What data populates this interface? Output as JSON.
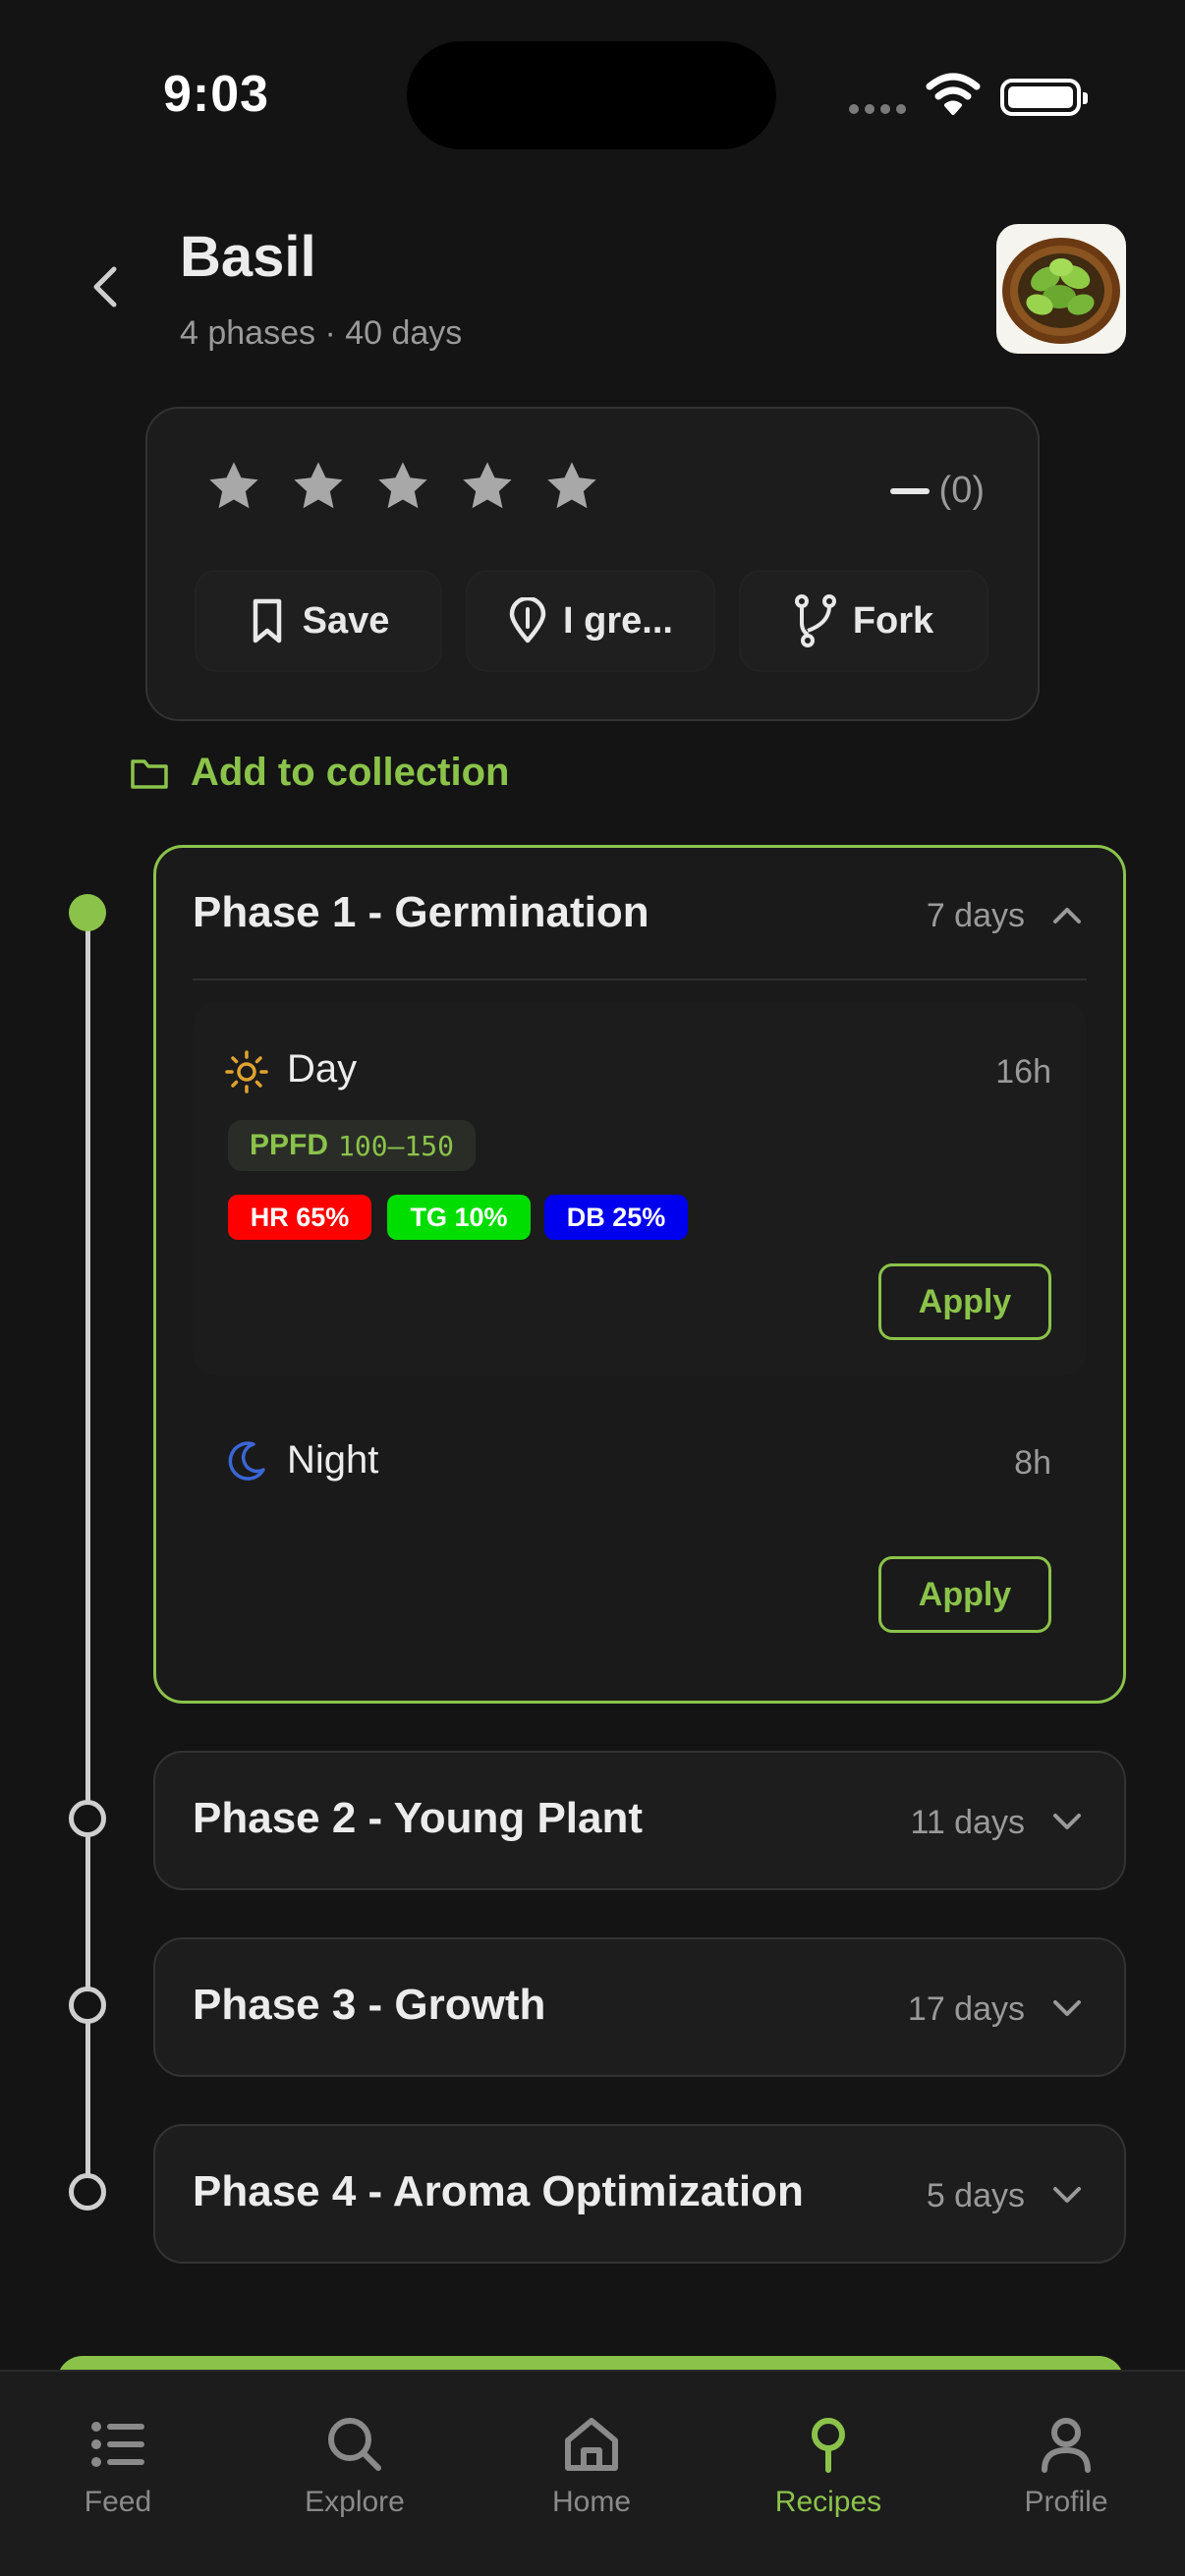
{
  "status": {
    "time": "9:03"
  },
  "header": {
    "title": "Basil",
    "subtitle": "4 phases · 40 days",
    "back_icon": "chevron-left-icon"
  },
  "rating": {
    "stars_filled": 0,
    "stars_total": 5,
    "count": "(0)"
  },
  "actions": [
    {
      "label": "Save",
      "icon": "bookmark-icon"
    },
    {
      "label": "I gre...",
      "icon": "pin-icon"
    },
    {
      "label": "Fork",
      "icon": "fork-icon"
    }
  ],
  "collection_link": "Add to collection",
  "phases": [
    {
      "title": "Phase 1 - Germination",
      "days": "7 days",
      "expanded": true,
      "day": {
        "label": "Day",
        "hours": "16h",
        "ppfd_label": "PPFD",
        "ppfd_value": "100–150",
        "chips": [
          {
            "label": "HR 65%",
            "color": "#ff0000"
          },
          {
            "label": "TG 10%",
            "color": "#00dd00"
          },
          {
            "label": "DB 25%",
            "color": "#0000ee"
          }
        ],
        "apply": "Apply"
      },
      "night": {
        "label": "Night",
        "hours": "8h",
        "apply": "Apply"
      }
    },
    {
      "title": "Phase 2 - Young Plant",
      "days": "11 days",
      "expanded": false
    },
    {
      "title": "Phase 3 - Growth",
      "days": "17 days",
      "expanded": false
    },
    {
      "title": "Phase 4 - Aroma Optimization",
      "days": "5 days",
      "expanded": false
    }
  ],
  "tabs": [
    {
      "label": "Feed",
      "icon": "list-icon",
      "active": false
    },
    {
      "label": "Explore",
      "icon": "search-icon",
      "active": false
    },
    {
      "label": "Home",
      "icon": "home-icon",
      "active": false
    },
    {
      "label": "Recipes",
      "icon": "pin-icon",
      "active": true
    },
    {
      "label": "Profile",
      "icon": "person-icon",
      "active": false
    }
  ],
  "colors": {
    "accent": "#8bc34a",
    "background": "#141414",
    "card": "#1c1c1c",
    "sun": "#e0a32e",
    "moon": "#3a66d6"
  }
}
